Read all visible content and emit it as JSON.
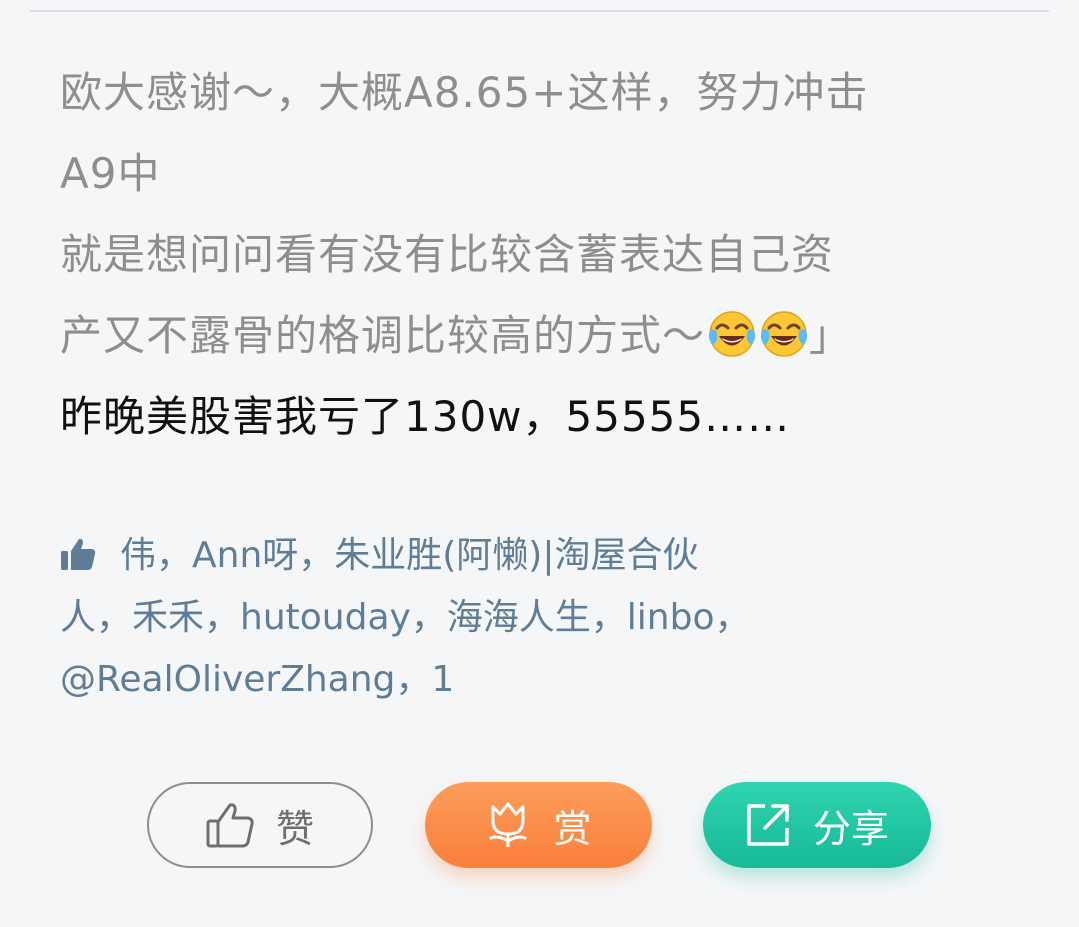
{
  "post": {
    "quoted_lines": [
      "欧大感谢～，大概A8.65+这样，努力冲击",
      "A9中",
      "就是想问问看有没有比较含蓄表达自己资",
      "产又不露骨的格调比较高的方式～"
    ],
    "quoted_end_emojis": [
      "laughing-crying-emoji",
      "laughing-crying-emoji"
    ],
    "quoted_end_mark": "」",
    "reply": "昨晚美股害我亏了130w，55555……"
  },
  "likes": {
    "icon": "thumbs-up-icon",
    "line1": "伟，Ann呀，朱业胜(阿懒)|淘屋合伙",
    "line2": "人，禾禾，hutouday，海海人生，linbo，",
    "line3": "@RealOliverZhang，1"
  },
  "actions": {
    "like_label": "赞",
    "reward_label": "赏",
    "share_label": "分享"
  },
  "colors": {
    "quoted_text": "#8e8e8e",
    "reply_text": "#111111",
    "likes_text": "#5f7d97",
    "reward_button": "#fb8a45",
    "share_button": "#21c6a3"
  }
}
